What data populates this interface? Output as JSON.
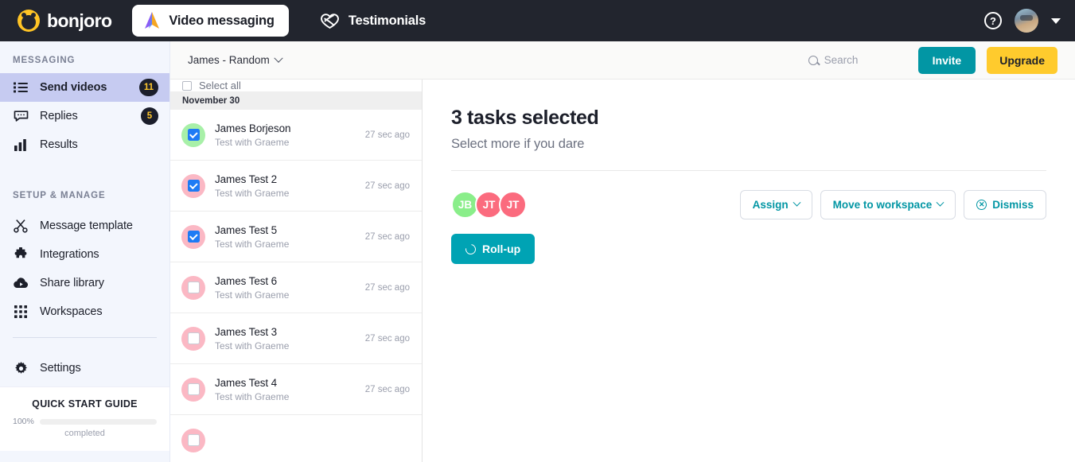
{
  "topnav": {
    "brand_name": "bonjoro",
    "brand_icon": "bonjoro-bear-logo",
    "items": [
      {
        "label": "Video messaging",
        "icon": "paper-plane-icon",
        "active": true
      },
      {
        "label": "Testimonials",
        "icon": "heart-infinity-icon",
        "active": false
      }
    ],
    "help_icon": "question-mark-icon",
    "avatar": "user-avatar",
    "account_caret": "chevron-down-icon"
  },
  "sidebar": {
    "section_messaging": "MESSAGING",
    "section_setup": "SETUP & MANAGE",
    "messaging_items": [
      {
        "label": "Send videos",
        "icon": "list-icon",
        "badge": "11",
        "active": true
      },
      {
        "label": "Replies",
        "icon": "chat-bubble-icon",
        "badge": "5",
        "active": false
      },
      {
        "label": "Results",
        "icon": "bar-chart-icon",
        "badge": "",
        "active": false
      }
    ],
    "setup_items": [
      {
        "label": "Message template",
        "icon": "scissors-icon",
        "badge": ""
      },
      {
        "label": "Integrations",
        "icon": "puzzle-icon",
        "badge": ""
      },
      {
        "label": "Share library",
        "icon": "cloud-play-icon",
        "badge": ""
      },
      {
        "label": "Workspaces",
        "icon": "grid-icon",
        "badge": ""
      }
    ],
    "settings_item": {
      "label": "Settings",
      "icon": "gear-icon"
    },
    "quick_start": {
      "title": "QUICK START GUIDE",
      "percent_label": "100%",
      "percent_value": 100,
      "completed_label": "completed",
      "bar_color": "#FFCB2D"
    }
  },
  "subbar": {
    "workspace": "James - Random",
    "workspace_caret": "chevron-down-icon",
    "search_placeholder": "Search",
    "search_value": "",
    "search_icon": "search-icon",
    "invite_label": "Invite",
    "upgrade_label": "Upgrade",
    "invite_color": "#0296A4",
    "upgrade_color": "#FFCB2D"
  },
  "tasklist": {
    "select_all_label": "Select all",
    "select_all_checked": false,
    "date_group": "November 30",
    "rows": [
      {
        "name": "James Borjeson",
        "subtitle": "Test with Graeme",
        "time": "27 sec ago",
        "checked": true,
        "avatar_color": "#A8F0A8"
      },
      {
        "name": "James Test 2",
        "subtitle": "Test with Graeme",
        "time": "27 sec ago",
        "checked": true,
        "avatar_color": "#FBB8C4"
      },
      {
        "name": "James Test 5",
        "subtitle": "Test with Graeme",
        "time": "27 sec ago",
        "checked": true,
        "avatar_color": "#FBB8C4"
      },
      {
        "name": "James Test 6",
        "subtitle": "Test with Graeme",
        "time": "27 sec ago",
        "checked": false,
        "avatar_color": "#FBB8C4"
      },
      {
        "name": "James Test 3",
        "subtitle": "Test with Graeme",
        "time": "27 sec ago",
        "checked": false,
        "avatar_color": "#FBB8C4"
      },
      {
        "name": "James Test 4",
        "subtitle": "Test with Graeme",
        "time": "27 sec ago",
        "checked": false,
        "avatar_color": "#FBB8C4"
      },
      {
        "name": "",
        "subtitle": "",
        "time": "",
        "checked": false,
        "avatar_color": "#FBB8C4"
      }
    ]
  },
  "detail": {
    "title": "3 tasks selected",
    "subtitle": "Select more if you dare",
    "avatars": [
      {
        "initials": "JB",
        "color": "#8AEE8A"
      },
      {
        "initials": "JT",
        "color": "#FB6B7E"
      },
      {
        "initials": "JT",
        "color": "#FB6B7E"
      }
    ],
    "assign_label": "Assign",
    "move_label": "Move to workspace",
    "dismiss_label": "Dismiss",
    "dismiss_icon": "circle-x-icon",
    "rollup_label": "Roll-up",
    "rollup_icon": "refresh-icon",
    "accent_teal": "#0296A4",
    "rollup_color": "#00A3B4"
  }
}
